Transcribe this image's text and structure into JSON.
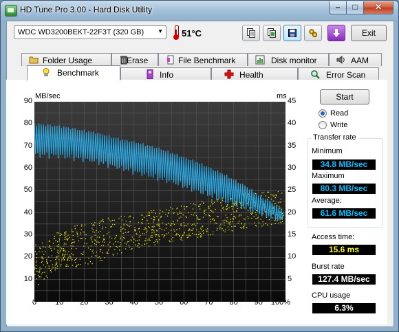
{
  "window": {
    "title": "HD Tune Pro 3.00 - Hard Disk Utility"
  },
  "toolbar": {
    "drive": "WDC WD3200BEKT-22F3T (320 GB)",
    "temperature": "51°C",
    "exit_label": "Exit"
  },
  "tabs_top": [
    {
      "label": "Folder Usage"
    },
    {
      "label": "Erase"
    },
    {
      "label": "File Benchmark"
    },
    {
      "label": "Disk monitor"
    },
    {
      "label": "AAM"
    }
  ],
  "tabs_bottom": [
    {
      "label": "Benchmark"
    },
    {
      "label": "Info"
    },
    {
      "label": "Health"
    },
    {
      "label": "Error Scan"
    }
  ],
  "chart_data": {
    "type": "line",
    "ylabel_left": "MB/sec",
    "ylabel_right": "ms",
    "y_left_range": [
      0,
      90
    ],
    "y_right_range": [
      0,
      45
    ],
    "y_left_ticks": [
      "90",
      "80",
      "70",
      "60",
      "50",
      "40",
      "30",
      "20",
      "10"
    ],
    "y_right_ticks": [
      "45",
      "40",
      "35",
      "30",
      "25",
      "20",
      "15",
      "10",
      "5"
    ],
    "x_ticks": [
      "0",
      "10",
      "20",
      "30",
      "40",
      "50",
      "60",
      "70",
      "80",
      "90",
      "100%"
    ],
    "x_range": [
      0,
      100
    ],
    "grid": true,
    "series": [
      {
        "color": "#2aa6e0",
        "x": [
          0,
          5,
          10,
          15,
          20,
          25,
          30,
          35,
          40,
          45,
          50,
          55,
          60,
          65,
          70,
          75,
          80,
          85,
          90,
          95,
          100
        ],
        "upper": [
          80,
          79.5,
          79,
          78,
          77,
          76,
          74.5,
          73,
          72,
          70.5,
          69,
          67,
          65,
          63,
          60.5,
          58,
          55,
          52,
          48,
          45,
          41
        ],
        "lower": [
          66,
          66,
          65.5,
          65,
          64,
          63,
          61.5,
          60,
          58.5,
          57,
          55.5,
          54,
          52,
          50,
          48,
          46,
          44,
          42,
          40,
          38,
          36
        ]
      },
      {
        "color": "#e6e600",
        "type": "scatter",
        "x_range": [
          0,
          100
        ],
        "y_range_ms": [
          [
            0,
            3,
            13
          ],
          [
            10,
            8,
            16
          ],
          [
            20,
            8,
            18
          ],
          [
            30,
            10,
            19
          ],
          [
            40,
            12,
            20
          ],
          [
            50,
            13,
            21
          ],
          [
            60,
            14,
            22
          ],
          [
            70,
            15,
            23
          ],
          [
            80,
            16,
            24
          ],
          [
            90,
            17,
            25
          ],
          [
            100,
            18,
            25
          ]
        ]
      }
    ]
  },
  "controls": {
    "start_label": "Start",
    "read_label": "Read",
    "write_label": "Write",
    "mode": "read"
  },
  "stats": {
    "transfer_rate_label": "Transfer rate",
    "minimum_label": "Minimum",
    "minimum": "34.8 MB/sec",
    "maximum_label": "Maximum",
    "maximum": "80.3 MB/sec",
    "average_label": "Average:",
    "average": "61.6 MB/sec",
    "access_time_label": "Access time:",
    "access_time": "15.6 ms",
    "burst_rate_label": "Burst rate",
    "burst_rate": "127.4 MB/sec",
    "cpu_usage_label": "CPU usage",
    "cpu_usage": "6.3%"
  }
}
